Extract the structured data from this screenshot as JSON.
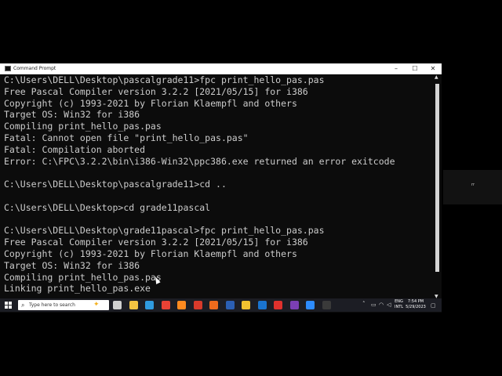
{
  "window": {
    "title": "Command Prompt",
    "controls": {
      "minimize": "–",
      "maximize": "☐",
      "close": "✕"
    }
  },
  "console": {
    "lines": [
      "C:\\Users\\DELL\\Desktop\\pascalgrade11>fpc print_hello_pas.pas",
      "Free Pascal Compiler version 3.2.2 [2021/05/15] for i386",
      "Copyright (c) 1993-2021 by Florian Klaempfl and others",
      "Target OS: Win32 for i386",
      "Compiling print_hello_pas.pas",
      "Fatal: Cannot open file \"print_hello_pas.pas\"",
      "Fatal: Compilation aborted",
      "Error: C:\\FPC\\3.2.2\\bin\\i386-Win32\\ppc386.exe returned an error exitcode",
      "",
      "C:\\Users\\DELL\\Desktop\\pascalgrade11>cd ..",
      "",
      "C:\\Users\\DELL\\Desktop>cd grade11pascal",
      "",
      "C:\\Users\\DELL\\Desktop\\grade11pascal>fpc print_hello_pas.pas",
      "Free Pascal Compiler version 3.2.2 [2021/05/15] for i386",
      "Copyright (c) 1993-2021 by Florian Klaempfl and others",
      "Target OS: Win32 for i386",
      "Compiling print_hello_pas.pas",
      "Linking print_hello_pas.exe"
    ],
    "foreground": "#cccccc",
    "background": "#0c0c0c"
  },
  "taskbar": {
    "search_placeholder": "Type here to search",
    "pinned_apps": [
      {
        "name": "task-view",
        "color": "#d0d0d0"
      },
      {
        "name": "file-explorer",
        "color": "#f5c542"
      },
      {
        "name": "edge",
        "color": "#2f9be0"
      },
      {
        "name": "chrome",
        "color": "#e94235"
      },
      {
        "name": "firefox",
        "color": "#ff8a1f"
      },
      {
        "name": "app-red",
        "color": "#d93a2b"
      },
      {
        "name": "app-orange",
        "color": "#f06b1d"
      },
      {
        "name": "word",
        "color": "#2b5fb4"
      },
      {
        "name": "app-yellow",
        "color": "#f2c230"
      },
      {
        "name": "outlook",
        "color": "#1a74d0"
      },
      {
        "name": "app-red-2",
        "color": "#e0312d"
      },
      {
        "name": "app-purple",
        "color": "#7b3fb5"
      },
      {
        "name": "zoom",
        "color": "#2d8cff"
      },
      {
        "name": "command-prompt",
        "color": "#3a3a3a"
      }
    ],
    "tray": {
      "language": "ENG",
      "keyboard": "INTL",
      "time": "7:54 PM",
      "date": "5/29/2023"
    }
  },
  "side_panel": {
    "text": "rr"
  }
}
